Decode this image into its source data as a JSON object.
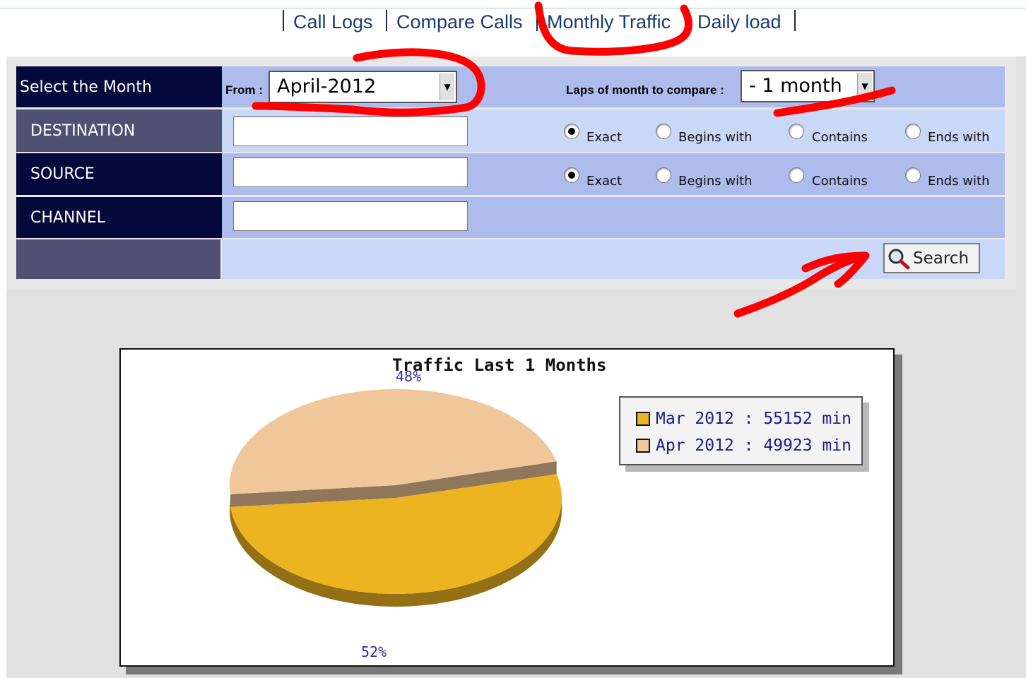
{
  "nav": {
    "links": [
      "Call Logs",
      "Compare Calls",
      "Monthly Traffic",
      "Daily load"
    ]
  },
  "form": {
    "month": {
      "label": "Select the Month",
      "from_label": "From :",
      "selected": "April-2012",
      "laps_label": "Laps of month to compare :",
      "laps_selected": "- 1 month"
    },
    "destination": {
      "label": "DESTINATION",
      "value": "",
      "options": [
        "Exact",
        "Begins with",
        "Contains",
        "Ends with"
      ],
      "selected": "Exact"
    },
    "source": {
      "label": "SOURCE",
      "value": "",
      "options": [
        "Exact",
        "Begins with",
        "Contains",
        "Ends with"
      ],
      "selected": "Exact"
    },
    "channel": {
      "label": "CHANNEL",
      "value": ""
    },
    "search_label": "Search"
  },
  "chart_data": {
    "type": "pie",
    "title": "Traffic Last 1 Months",
    "labels": [
      "Mar 2012",
      "Apr 2012"
    ],
    "values": [
      55152,
      49923
    ],
    "unit": "min",
    "legend": [
      "Mar 2012 : 55152 min",
      "Apr 2012 : 49923 min"
    ],
    "percent_labels": [
      "52%",
      "48%"
    ],
    "colors": [
      "#edb422",
      "#f0c79a"
    ],
    "legend_position": "right"
  },
  "icons": {
    "search": "magnifier-icon",
    "dropdown": "dropdown-arrow-icon"
  }
}
